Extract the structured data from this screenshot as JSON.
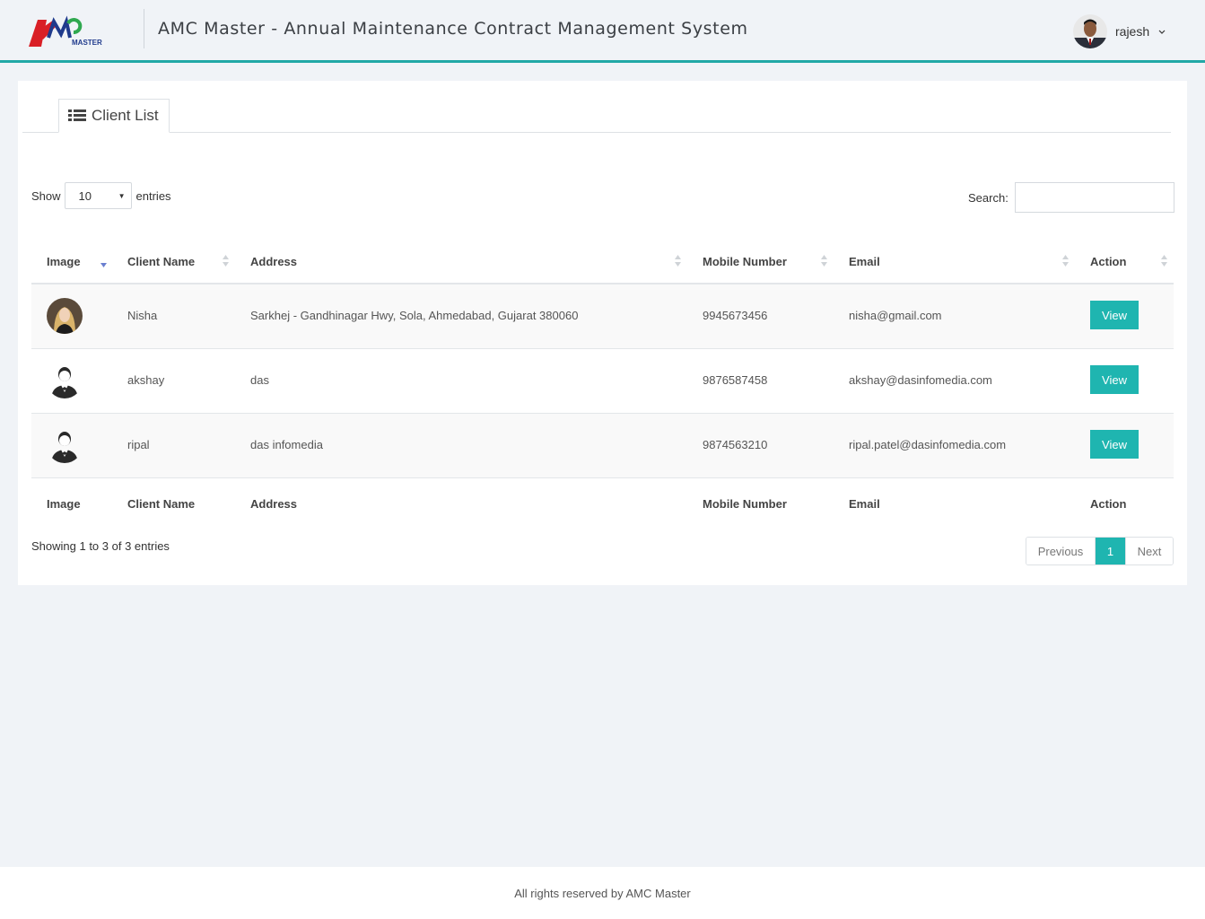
{
  "header": {
    "logo_text": "MASTER",
    "title": "AMC Master - Annual Maintenance Contract Management System",
    "user_name": "rajesh"
  },
  "tab": {
    "label": "Client List"
  },
  "controls": {
    "show_label": "Show",
    "page_length": "10",
    "entries_label": "entries",
    "search_label": "Search:",
    "search_value": ""
  },
  "table": {
    "columns": [
      "Image",
      "Client Name",
      "Address",
      "Mobile Number",
      "Email",
      "Action"
    ],
    "rows": [
      {
        "name": "Nisha",
        "address": "Sarkhej - Gandhinagar Hwy, Sola, Ahmedabad, Gujarat 380060",
        "mobile": "9945673456",
        "email": "nisha@gmail.com",
        "action": "View",
        "image": "woman-photo"
      },
      {
        "name": "akshay",
        "address": "das",
        "mobile": "9876587458",
        "email": "akshay@dasinfomedia.com",
        "action": "View",
        "image": "default-user-icon"
      },
      {
        "name": "ripal",
        "address": "das infomedia",
        "mobile": "9874563210",
        "email": "ripal.patel@dasinfomedia.com",
        "action": "View",
        "image": "default-user-icon"
      }
    ]
  },
  "pagination": {
    "info": "Showing 1 to 3 of 3 entries",
    "previous": "Previous",
    "current": "1",
    "next": "Next"
  },
  "footer": {
    "text": "All rights reserved by AMC Master"
  },
  "colors": {
    "accent": "#1fb5b0",
    "header_border": "#21a8a6",
    "logo_red": "#d91f26",
    "logo_green": "#2fa84f",
    "logo_blue": "#1f3a8c"
  }
}
